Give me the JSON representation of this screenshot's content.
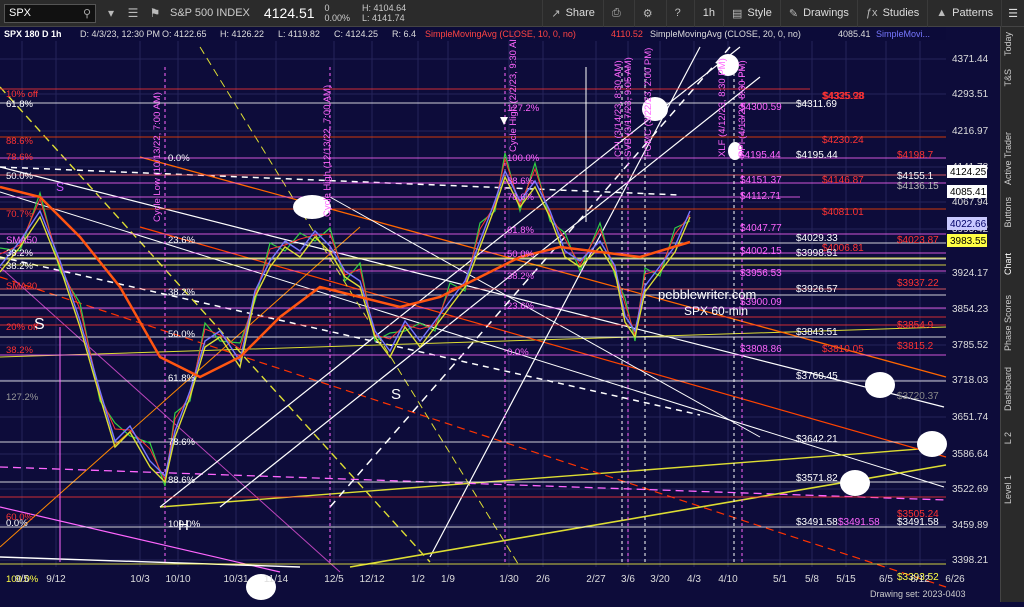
{
  "toolbar": {
    "symbol": "SPX",
    "index_name": "S&P 500 INDEX",
    "last": "4124.51",
    "change_pts": "0",
    "change_pct": "0.00%",
    "high": "H: 4104.64",
    "low": "L: 4141.74",
    "share": "Share",
    "interval": "1h",
    "style": "Style",
    "drawings": "Drawings",
    "studies": "Studies",
    "patterns": "Patterns"
  },
  "chart_header": {
    "info": "SPX 180 D 1h",
    "date": "D: 4/3/23, 12:30 PM",
    "open": "O: 4122.65",
    "high": "H: 4126.22",
    "low": "L: 4119.82",
    "close": "C: 4124.25",
    "range": "R: 6.4",
    "sma10": "SimpleMovingAvg (CLOSE, 10, 0, no)",
    "sma10_val": "4110.52",
    "sma20": "SimpleMovingAvg (CLOSE, 20, 0, no)",
    "sma20_val": "4085.41",
    "more": "SimpleMovi..."
  },
  "right_tabs": [
    "Today",
    "T&S",
    "Active Trader",
    "Buttons",
    "Chart",
    "Phase Scores",
    "Dashboard",
    "L 2",
    "Level 1"
  ],
  "active_tab": "Chart",
  "price_axis": [
    "4371.44",
    "4293.51",
    "4216.97",
    "4141.78",
    "4067.94",
    "3995.42",
    "3924.17",
    "3854.23",
    "3785.52",
    "3718.03",
    "3651.74",
    "3586.64",
    "3522.69",
    "3459.89",
    "3398.21"
  ],
  "price_markers": [
    {
      "label": "4124.25",
      "bg": "#ffffff",
      "fg": "#000000"
    },
    {
      "label": "4085.41",
      "bg": "#ffffff",
      "fg": "#000000"
    },
    {
      "label": "4022.66",
      "bg": "#c9c9ff",
      "fg": "#000066"
    },
    {
      "label": "3983.55",
      "bg": "#ffff44",
      "fg": "#000000"
    }
  ],
  "time_axis": [
    "9/5",
    "9/12",
    "10/3",
    "10/10",
    "10/31",
    "11/14",
    "12/5",
    "12/12",
    "1/2",
    "1/9",
    "1/30",
    "2/6",
    "2/27",
    "3/6",
    "3/20",
    "4/3",
    "4/10",
    "5/1",
    "5/8",
    "5/15",
    "6/5",
    "6/12",
    "6/26"
  ],
  "level_labels": [
    {
      "text": "$4335.98",
      "color": "#ff3333"
    },
    {
      "text": "$4311.69",
      "color": "#ffffff"
    },
    {
      "text": "$4325.28",
      "color": "#ff3333"
    },
    {
      "text": "$4300.59",
      "color": "#ff66ff"
    },
    {
      "text": "$4230.24",
      "color": "#ff3333"
    },
    {
      "text": "$4198.7",
      "color": "#ff3333"
    },
    {
      "text": "$4195.44",
      "color": "#ffffff"
    },
    {
      "text": "$4195.44",
      "color": "#ff66ff"
    },
    {
      "text": "$4155.1",
      "color": "#ffffff"
    },
    {
      "text": "$4151.37",
      "color": "#ff66ff"
    },
    {
      "text": "$4146.87",
      "color": "#ff3333"
    },
    {
      "text": "$4136.15",
      "color": "#bbbbbb"
    },
    {
      "text": "$4112.71",
      "color": "#ff66ff"
    },
    {
      "text": "$4081.01",
      "color": "#ff3333"
    },
    {
      "text": "$4047.77",
      "color": "#ff66ff"
    },
    {
      "text": "$4029.33",
      "color": "#ffffff"
    },
    {
      "text": "$4023.87",
      "color": "#ff3333"
    },
    {
      "text": "$4006.81",
      "color": "#ff3333"
    },
    {
      "text": "$4002.15",
      "color": "#ff66ff"
    },
    {
      "text": "$3998.51",
      "color": "#ffffff"
    },
    {
      "text": "$3956.53",
      "color": "#ff66ff"
    },
    {
      "text": "$3937.22",
      "color": "#ff3333"
    },
    {
      "text": "$3926.57",
      "color": "#ffffff"
    },
    {
      "text": "$3900.09",
      "color": "#ff66ff"
    },
    {
      "text": "$3854.9",
      "color": "#ff3333"
    },
    {
      "text": "$3843.51",
      "color": "#ffffff"
    },
    {
      "text": "$3815.2",
      "color": "#ff3333"
    },
    {
      "text": "$3810.05",
      "color": "#ff3333"
    },
    {
      "text": "$3808.86",
      "color": "#ff66ff"
    },
    {
      "text": "$3760.45",
      "color": "#ffffff"
    },
    {
      "text": "$3720.37",
      "color": "#888888"
    },
    {
      "text": "$3642.21",
      "color": "#ffffff"
    },
    {
      "text": "$3571.82",
      "color": "#ffffff"
    },
    {
      "text": "$3505.24",
      "color": "#ff3333"
    },
    {
      "text": "$3491.58",
      "color": "#ffffff"
    },
    {
      "text": "$3491.58",
      "color": "#ff66ff"
    },
    {
      "text": "$3491.58",
      "color": "#ffffff"
    },
    {
      "text": "$3393.52",
      "color": "#ffff44"
    }
  ],
  "fib_left": [
    {
      "text": "10% off",
      "color": "#ff3333"
    },
    {
      "text": "61.8%",
      "color": "#ffffff"
    },
    {
      "text": "88.6%",
      "color": "#ff3333"
    },
    {
      "text": "78.6%",
      "color": "#ff3333"
    },
    {
      "text": "50.0%",
      "color": "#ffffff"
    },
    {
      "text": "70.7%",
      "color": "#ff3333"
    },
    {
      "text": "SMA50",
      "color": "#ff66ff"
    },
    {
      "text": "38.2%",
      "color": "#ffffff"
    },
    {
      "text": "38.2%",
      "color": "#ffffff"
    },
    {
      "text": "SMA20",
      "color": "#ff3333"
    },
    {
      "text": "20% off",
      "color": "#ff3333"
    },
    {
      "text": "38.2%",
      "color": "#ff3333"
    },
    {
      "text": "127.2%",
      "color": "#999999"
    },
    {
      "text": "60.0%",
      "color": "#ff3333"
    },
    {
      "text": "0.0%",
      "color": "#ffffff"
    },
    {
      "text": "100.0%",
      "color": "#ffff44"
    }
  ],
  "fib_mid": [
    "0.0%",
    "23.6%",
    "38.2%",
    "50.0%",
    "61.8%",
    "78.6%",
    "88.6%",
    "100.0%"
  ],
  "fib_right": [
    "127.2%",
    "100.0%",
    "88.6%",
    "78.6%",
    "61.8%",
    "50.0%",
    "38.2%",
    "23.6%",
    "0.0%"
  ],
  "vertical_labels": [
    "Cycle Low (10/13/22, 7:00 AM)",
    "Cycle High (12/13/22, 7:00 AM)",
    "Cycle High (2/2/23, 9:30 AM)",
    "CPI (3/14/23, 8:30 AM)",
    "SVB (3/17/23, 9:05 AM)",
    "FOMC (3/22/23, 2:00 PM)",
    "XLF (4/12/23, 8:30 PM)",
    "PPI (4/13/23, 8:30 PM)"
  ],
  "annotations": {
    "s1": "S",
    "s2": "S",
    "s3": "S",
    "h": "H",
    "brand": "pebblewriter.com",
    "brand_sub": "SPX 60-min"
  },
  "footer": {
    "drawing_set": "Drawing set: 2023-0403"
  }
}
